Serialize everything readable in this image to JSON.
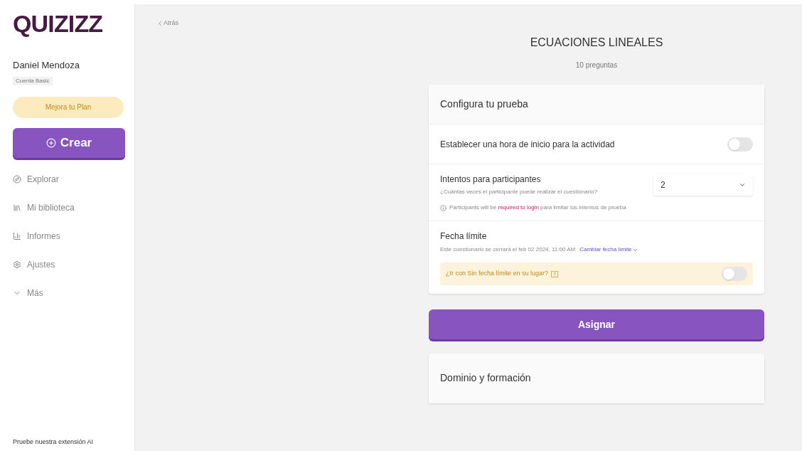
{
  "sidebar": {
    "logo": "QUIZIZZ",
    "user_name": "Daniel Mendoza",
    "account": "Cuenta Basic",
    "upgrade": "Mejora tu Plan",
    "create": "Crear",
    "items": [
      {
        "label": "Explorar"
      },
      {
        "label": "Mi biblioteca"
      },
      {
        "label": "Informes"
      },
      {
        "label": "Ajustes"
      },
      {
        "label": "Más"
      }
    ],
    "footer": "Pruebe nuestra extensión AI"
  },
  "back": "Atrás",
  "quiz": {
    "title": "ECUACIONES LINEALES",
    "subtitle": "10 preguntas"
  },
  "config": {
    "title": "Configura tu prueba",
    "start_time": {
      "label": "Establecer una hora de inicio para la actividad",
      "on": false
    },
    "attempts": {
      "label": "Intentos para participantes",
      "hint": "¿Cuántas veces el participante puede realizar el cuestionario?",
      "value": "2",
      "note_before": "Participants will be",
      "note_link": "required to login",
      "note_after": "para limitar los intentos de prueba"
    },
    "deadline": {
      "label": "Fecha límite",
      "text": "Este cuestionario se cerrará el feb 02 2024, 11:00 AM",
      "link": "Cambiar fecha límite",
      "alt": "¿Ir con Sin fecha límite en su lugar?",
      "alt_badge": "?",
      "on": false
    }
  },
  "assign": "Asignar",
  "mastery": {
    "title": "Dominio y formación"
  }
}
